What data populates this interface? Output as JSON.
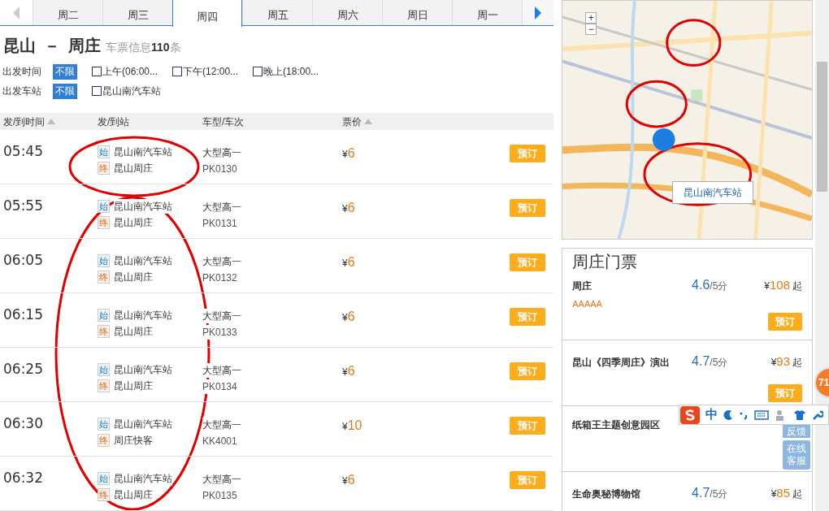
{
  "date_tabs": [
    {
      "label": "周二",
      "selected": false
    },
    {
      "label": "周三",
      "selected": false
    },
    {
      "label": "周四",
      "selected": true
    },
    {
      "label": "周五",
      "selected": false
    },
    {
      "label": "周六",
      "selected": false
    },
    {
      "label": "周日",
      "selected": false
    },
    {
      "label": "周一",
      "selected": false
    }
  ],
  "prev_disabled": true,
  "route": {
    "from": "昆山",
    "separator": "－",
    "to": "周庄",
    "info_label": "车票信息",
    "count": "110",
    "unit": "条"
  },
  "filters": [
    {
      "label": "出发时间",
      "all": {
        "label": "不限",
        "selected": true
      },
      "options": [
        {
          "label": "上午(06:00...",
          "checked": false
        },
        {
          "label": "下午(12:00...",
          "checked": false
        },
        {
          "label": "晚上(18:00...",
          "checked": false
        }
      ]
    },
    {
      "label": "出发车站",
      "all": {
        "label": "不限",
        "selected": true
      },
      "options": [
        {
          "label": "昆山南汽车站",
          "checked": false
        }
      ]
    }
  ],
  "table": {
    "columns": [
      {
        "label": "发/到时间",
        "sortable": true
      },
      {
        "label": "发/到站",
        "sortable": false
      },
      {
        "label": "车型/车次",
        "sortable": false
      },
      {
        "label": "票价",
        "sortable": true
      }
    ],
    "rows": [
      {
        "time": "05:45",
        "start_tag": "始",
        "start": "昆山南汽车站",
        "end_tag": "终",
        "end": "昆山周庄",
        "bus_type": "大型高一",
        "number": "PK0130",
        "currency": "¥",
        "price": "6",
        "action": "预订"
      },
      {
        "time": "05:55",
        "start_tag": "始",
        "start": "昆山南汽车站",
        "end_tag": "终",
        "end": "昆山周庄",
        "bus_type": "大型高一",
        "number": "PK0131",
        "currency": "¥",
        "price": "6",
        "action": "预订"
      },
      {
        "time": "06:05",
        "start_tag": "始",
        "start": "昆山南汽车站",
        "end_tag": "终",
        "end": "昆山周庄",
        "bus_type": "大型高一",
        "number": "PK0132",
        "currency": "¥",
        "price": "6",
        "action": "预订"
      },
      {
        "time": "06:15",
        "start_tag": "始",
        "start": "昆山南汽车站",
        "end_tag": "终",
        "end": "昆山周庄",
        "bus_type": "大型高一",
        "number": "PK0133",
        "currency": "¥",
        "price": "6",
        "action": "预订"
      },
      {
        "time": "06:25",
        "start_tag": "始",
        "start": "昆山南汽车站",
        "end_tag": "终",
        "end": "昆山周庄",
        "bus_type": "大型高一",
        "number": "PK0134",
        "currency": "¥",
        "price": "6",
        "action": "预订"
      },
      {
        "time": "06:30",
        "start_tag": "始",
        "start": "昆山南汽车站",
        "end_tag": "终",
        "end": "周庄快客",
        "bus_type": "大型高一",
        "number": "KK4001",
        "currency": "¥",
        "price": "10",
        "action": "预订"
      },
      {
        "time": "06:32",
        "start_tag": "始",
        "start": "昆山南汽车站",
        "end_tag": "终",
        "end": "昆山周庄",
        "bus_type": "大型高一",
        "number": "PK0135",
        "currency": "¥",
        "price": "6",
        "action": "预订"
      }
    ]
  },
  "map": {
    "kind": "picture",
    "popup": "昆山南汽车站",
    "zoom_in": "+",
    "zoom_out": "−"
  },
  "tickets": {
    "title": "周庄门票",
    "items": [
      {
        "name": "周庄",
        "score": "4.6",
        "score_unit": "/5分",
        "currency": "¥",
        "price": "108",
        "price_suffix": "起",
        "grade": "AAAAA",
        "action": "预订"
      },
      {
        "name": "昆山《四季周庄》演出",
        "score": "4.7",
        "score_unit": "/5分",
        "currency": "¥",
        "price": "93",
        "price_suffix": "起",
        "action": "预订"
      },
      {
        "name": "纸箱王主题创意园区"
      },
      {
        "name": "生命奥秘博物馆",
        "score": "4.7",
        "score_unit": "/5分",
        "currency": "¥",
        "price": "85",
        "price_suffix": "起"
      }
    ]
  },
  "ime_toolbar": {
    "mode": "中"
  },
  "side_buttons": [
    {
      "label": "反馈"
    },
    {
      "label": "在线客服"
    }
  ],
  "badge": "71"
}
